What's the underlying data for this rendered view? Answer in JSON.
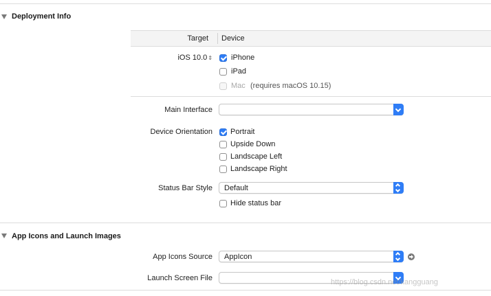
{
  "sections": {
    "deployment": {
      "title": "Deployment Info"
    },
    "app_icons": {
      "title": "App Icons and Launch Images"
    }
  },
  "table": {
    "col_target": "Target",
    "col_device": "Device"
  },
  "deployment": {
    "ios_version": "iOS 10.0",
    "devices": {
      "iphone": {
        "label": "iPhone",
        "checked": true
      },
      "ipad": {
        "label": "iPad",
        "checked": false
      },
      "mac": {
        "label": "Mac",
        "note": "(requires macOS 10.15)",
        "checked": false,
        "disabled": true
      }
    },
    "main_interface": {
      "label": "Main Interface",
      "value": ""
    },
    "device_orientation": {
      "label": "Device Orientation",
      "options": [
        {
          "label": "Portrait",
          "checked": true
        },
        {
          "label": "Upside Down",
          "checked": false
        },
        {
          "label": "Landscape Left",
          "checked": false
        },
        {
          "label": "Landscape Right",
          "checked": false
        }
      ]
    },
    "status_bar_style": {
      "label": "Status Bar Style",
      "value": "Default"
    },
    "hide_status_bar": {
      "label": "Hide status bar",
      "checked": false
    }
  },
  "app_icons": {
    "source": {
      "label": "App Icons Source",
      "value": "AppIcon"
    },
    "launch_screen": {
      "label": "Launch Screen File",
      "value": ""
    }
  },
  "watermark": "https://blog.csdn.net/kangguang",
  "colors": {
    "accent": "#2f7df6",
    "divider": "#dcdcdc",
    "header_bg": "#f4f4f4",
    "disabled_text": "#a8a8a8"
  },
  "icons": {
    "disclosure": "disclosure-triangle-down-icon",
    "stepper": "up-down-chevron-icon",
    "arrow": "circle-arrow-right-icon"
  }
}
